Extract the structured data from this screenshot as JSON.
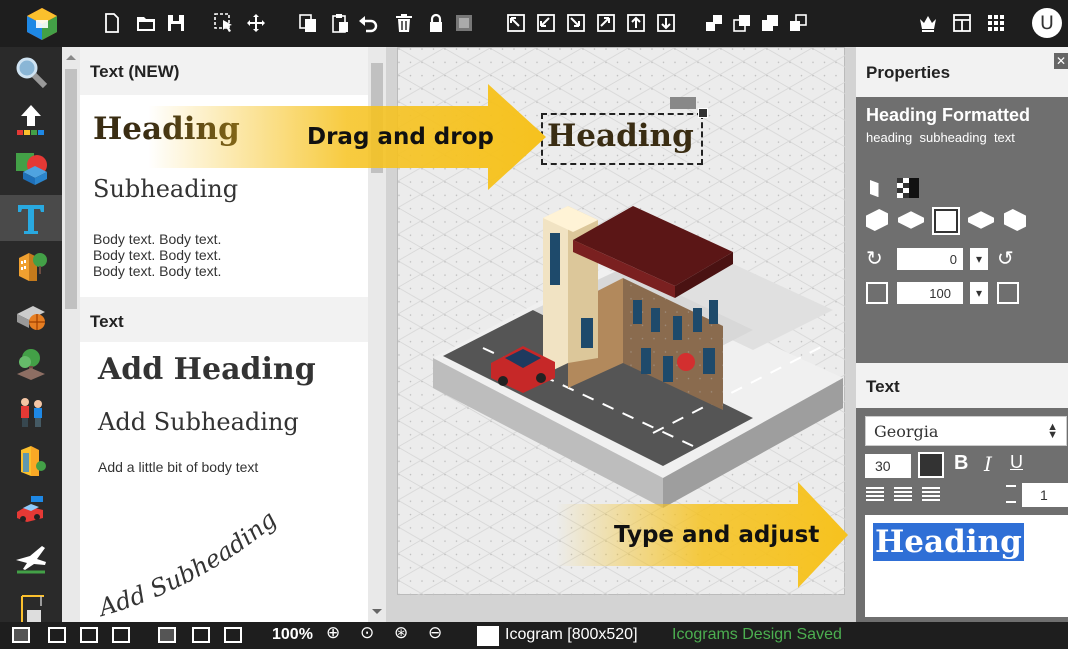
{
  "toolbar": {
    "icons": [
      "new-file",
      "open-folder",
      "save",
      "select",
      "move",
      "copy",
      "paste",
      "undo",
      "delete",
      "lock",
      "group",
      "align-top-left",
      "align-bottom",
      "align-left",
      "align-right",
      "send-up",
      "send-down",
      "bring-front",
      "bring-forward",
      "send-backward",
      "send-back",
      "crown",
      "layout",
      "grid",
      "user"
    ],
    "user_initial": "U"
  },
  "sidebar": {
    "items": [
      "search",
      "upload",
      "shapes",
      "text",
      "buildings",
      "objects",
      "trees",
      "people",
      "city",
      "vehicles",
      "transport",
      "construction"
    ],
    "active": "text"
  },
  "panel": {
    "section1_title": "Text (NEW)",
    "new_heading": "Heading",
    "new_subheading": "Subheading",
    "new_body_lines": [
      "Body text. Body text.",
      "Body text. Body text.",
      "Body text. Body text."
    ],
    "section2_title": "Text",
    "add_heading": "Add Heading",
    "add_subheading": "Add Subheading",
    "add_body": "Add a little bit of body text",
    "curved_subheading": "Add Subheading"
  },
  "canvas": {
    "heading_text": "Heading",
    "callout_drag": "Drag and drop",
    "callout_type": "Type and adjust",
    "accent": "#f6c21e"
  },
  "properties": {
    "title": "Properties",
    "element_title": "Heading Formatted",
    "element_tags": "heading  subheading  text",
    "rotation": "0",
    "scale": "100",
    "text_section_title": "Text",
    "font": "Georgia",
    "font_size": "30",
    "line_height": "1",
    "editor_text": "Heading"
  },
  "statusbar": {
    "zoom": "100%",
    "doc_name": "Icogram [800x520]",
    "save_status": "Icograms Design Saved",
    "save_color": "#4caf50"
  }
}
